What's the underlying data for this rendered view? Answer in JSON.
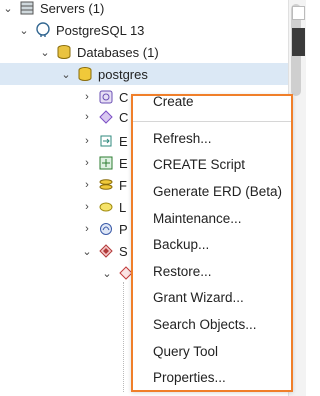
{
  "tree": {
    "servers_label": "Servers (1)",
    "server_label": "PostgreSQL 13",
    "databases_label": "Databases (1)",
    "database_label": "postgres",
    "children_partial": [
      "C",
      "C",
      "E",
      "E",
      "F",
      "L",
      "P",
      "S"
    ]
  },
  "context_menu": {
    "items": [
      "Create",
      "Refresh...",
      "CREATE Script",
      "Generate ERD (Beta)",
      "Maintenance...",
      "Backup...",
      "Restore...",
      "Grant Wizard...",
      "Search Objects...",
      "Query Tool",
      "Properties..."
    ]
  },
  "colors": {
    "menu_border": "#f07f2a",
    "selection": "#dbe8f5"
  }
}
